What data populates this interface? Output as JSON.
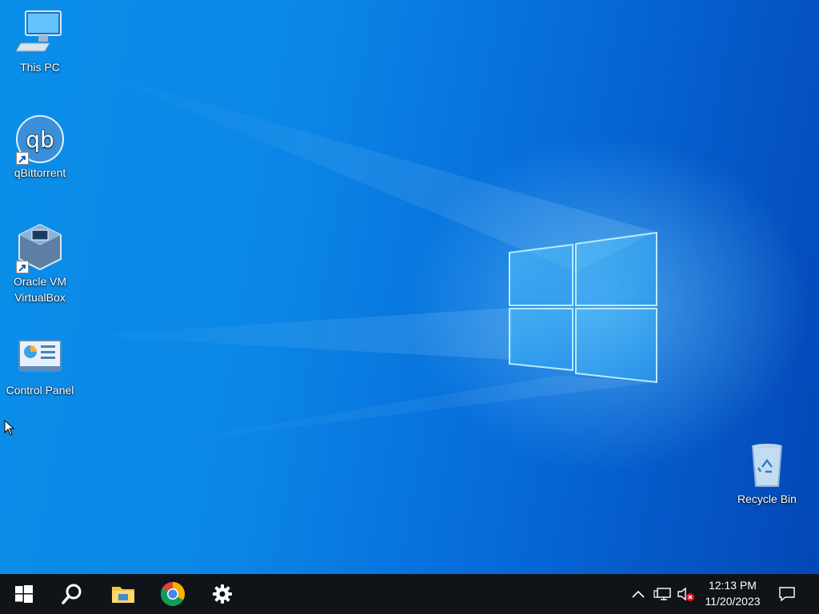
{
  "desktop": {
    "icons": [
      {
        "label": "This PC",
        "icon": "computer-icon"
      },
      {
        "label": "qBittorrent",
        "icon": "qbittorrent-icon",
        "logo_text": "qb"
      },
      {
        "label_line1": "Oracle VM",
        "label_line2": "VirtualBox",
        "icon": "virtualbox-icon"
      },
      {
        "label": "Control Panel",
        "icon": "control-panel-icon"
      },
      {
        "label": "Recycle Bin",
        "icon": "recycle-bin-icon"
      }
    ]
  },
  "taskbar": {
    "pinned": [
      {
        "icon": "windows-start-icon"
      },
      {
        "icon": "search-icon"
      },
      {
        "icon": "file-explorer-icon"
      },
      {
        "icon": "chrome-icon"
      },
      {
        "icon": "settings-gear-icon"
      }
    ],
    "tray": {
      "icons": [
        "chevron-up-icon",
        "network-icon",
        "volume-muted-icon"
      ]
    },
    "clock": {
      "time": "12:13 PM",
      "date": "11/20/2023"
    },
    "notification_icon": "action-center-icon"
  },
  "colors": {
    "desktop_background": "#0a7fe0",
    "taskbar_background": "#101418",
    "text": "#ffffff"
  }
}
